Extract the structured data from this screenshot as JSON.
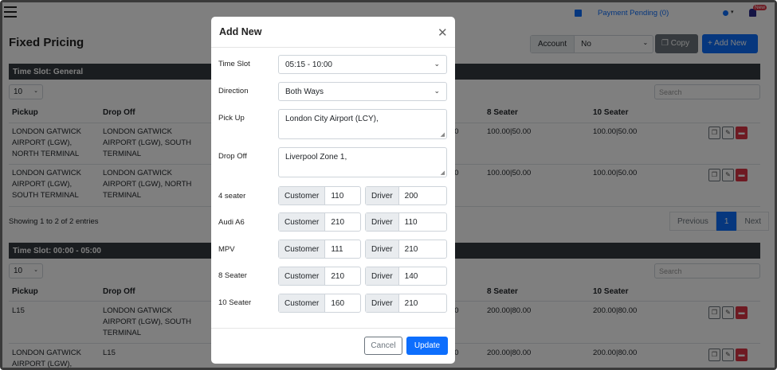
{
  "header": {
    "payment_pending": "Payment Pending (0)",
    "new_badge": "New",
    "page_title": "Fixed Pricing",
    "account_label": "Account",
    "account_value": "No",
    "copy_label": "Copy",
    "add_new_label": "Add New"
  },
  "sections": [
    {
      "title": "Time Slot: General",
      "page_length": "10",
      "search_placeholder": "Search",
      "columns": [
        "Pickup",
        "Drop Off",
        "8 Seater",
        "10 Seater"
      ],
      "rows": [
        {
          "pickup": "LONDON GATWICK AIRPORT (LGW), NORTH TERMINAL",
          "dropoff": "LONDON GATWICK AIRPORT (LGW), SOUTH TERMINAL",
          "c8": "100.00|50.00",
          "c10": "100.00|50.00"
        },
        {
          "pickup": "LONDON GATWICK AIRPORT (LGW), SOUTH TERMINAL",
          "dropoff": "LONDON GATWICK AIRPORT (LGW), NORTH TERMINAL",
          "c8": "100.00|50.00",
          "c10": "100.00|50.00"
        }
      ],
      "entries": "Showing 1 to 2 of 2 entries",
      "pager": {
        "previous": "Previous",
        "page": "1",
        "next": "Next"
      }
    },
    {
      "title": "Time Slot: 00:00 - 05:00",
      "page_length": "10",
      "search_placeholder": "Search",
      "columns": [
        "Pickup",
        "Drop Off",
        "8 Seater",
        "10 Seater"
      ],
      "rows": [
        {
          "pickup": "L15",
          "dropoff": "LONDON GATWICK AIRPORT (LGW), SOUTH TERMINAL",
          "c8": "200.00|80.00",
          "c10": "200.00|80.00"
        },
        {
          "pickup": "LONDON GATWICK AIRPORT (LGW),",
          "dropoff": "L15",
          "c8": "200.00|80.00",
          "c10": "200.00|80.00"
        }
      ]
    }
  ],
  "clipped_prefix": "00",
  "modal": {
    "title": "Add New",
    "time_slot_label": "Time Slot",
    "time_slot_value": "05:15 - 10:00",
    "direction_label": "Direction",
    "direction_value": "Both Ways",
    "pickup_label": "Pick Up",
    "pickup_value": "London City Airport (LCY),",
    "dropoff_label": "Drop Off",
    "dropoff_value": "Liverpool Zone 1,",
    "customer_label": "Customer",
    "driver_label": "Driver",
    "vehicles": [
      {
        "label": "4 seater",
        "customer": "110",
        "driver": "200"
      },
      {
        "label": "Audi A6",
        "customer": "210",
        "driver": "110"
      },
      {
        "label": "MPV",
        "customer": "111",
        "driver": "210"
      },
      {
        "label": "8 Seater",
        "customer": "210",
        "driver": "140"
      },
      {
        "label": "10 Seater",
        "customer": "160",
        "driver": "210"
      }
    ],
    "cancel_label": "Cancel",
    "update_label": "Update"
  },
  "colors": {
    "primary": "#0d6efd",
    "secondary": "#6c757d",
    "danger": "#dc3545",
    "dark_header": "#343a40"
  }
}
